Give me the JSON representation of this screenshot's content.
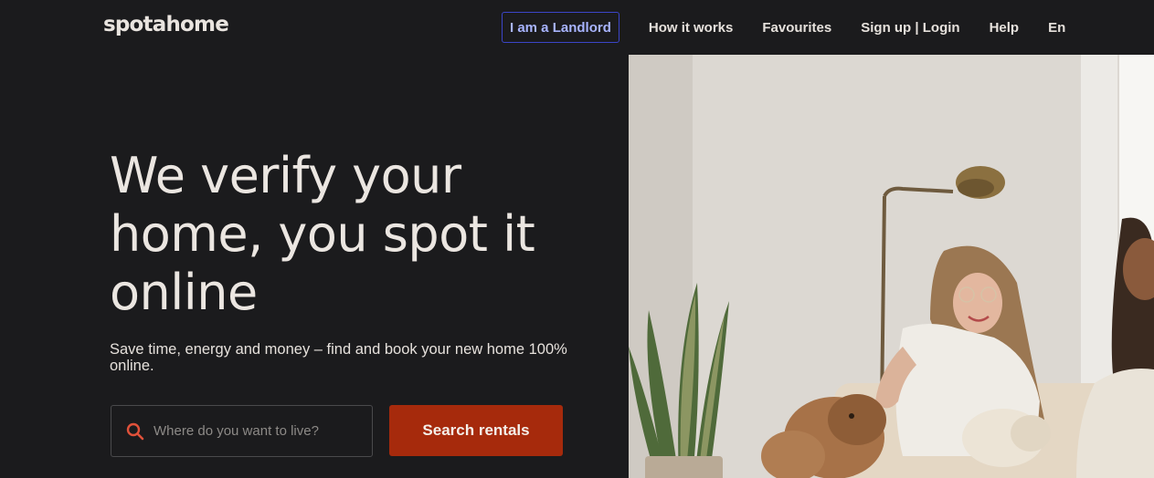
{
  "header": {
    "logo": "spotahome",
    "nav": {
      "landlord": "I am a Landlord",
      "how_it_works": "How it works",
      "favourites": "Favourites",
      "sign_up_login": "Sign up | Login",
      "help": "Help",
      "language": "En"
    }
  },
  "hero": {
    "title": "We verify your home, you spot it online",
    "subtitle": "Save time, energy and money – find and book your new home 100% online.",
    "search": {
      "placeholder": "Where do you want to live?",
      "icon": "search-icon",
      "button_label": "Search rentals"
    },
    "image": "photo of smiling women with dogs in a bright living room"
  },
  "colors": {
    "background": "#1b1b1d",
    "accent_button": "#a62a0c",
    "landlord_border": "#3b45c8",
    "landlord_text": "#a8b4ff",
    "search_icon": "#e0513a"
  }
}
